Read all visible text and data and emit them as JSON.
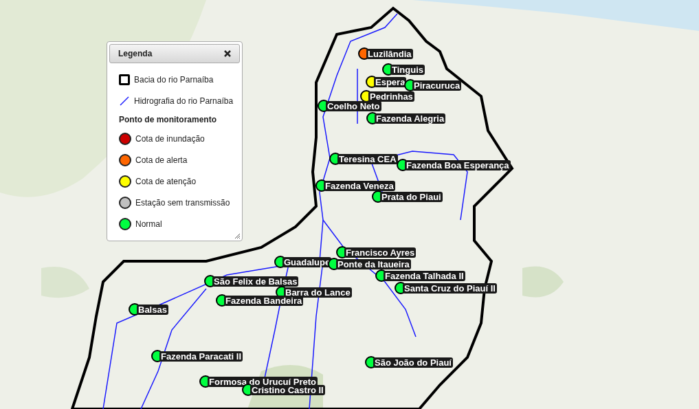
{
  "legend": {
    "title": "Legenda",
    "items": [
      {
        "kind": "basin",
        "label": "Bacia do rio Parnaíba"
      },
      {
        "kind": "river",
        "label": "Hidrografia do rio Parnaíba"
      },
      {
        "kind": "heading",
        "label": "Ponto de monitoramento"
      },
      {
        "kind": "status",
        "label": "Cota de inundação",
        "color": "#cc0000"
      },
      {
        "kind": "status",
        "label": "Cota de alerta",
        "color": "#ff6600"
      },
      {
        "kind": "status",
        "label": "Cota de atenção",
        "color": "#ffff00"
      },
      {
        "kind": "status",
        "label": "Estação sem transmissão",
        "color": "#c0c0c0"
      },
      {
        "kind": "status",
        "label": "Normal",
        "color": "#00ff40"
      }
    ]
  },
  "stations": [
    {
      "label": "Luzilândia",
      "color": "#ff6600"
    },
    {
      "label": "Tinguis",
      "color": "#00ff40"
    },
    {
      "label": "Espera",
      "color": "#ffff00"
    },
    {
      "label": "Piracuruca",
      "color": "#00ff40"
    },
    {
      "label": "Pedrinhas",
      "color": "#ffff00"
    },
    {
      "label": "Coelho Neto",
      "color": "#00ff40"
    },
    {
      "label": "Fazenda Alegria",
      "color": "#00ff40"
    },
    {
      "label": "Teresina CEA",
      "color": "#00ff40"
    },
    {
      "label": "Fazenda Boa Esperança",
      "color": "#00ff40"
    },
    {
      "label": "Fazenda Veneza",
      "color": "#00ff40"
    },
    {
      "label": "Prata do Piaui",
      "color": "#00ff40"
    },
    {
      "label": "Francisco Ayres",
      "color": "#00ff40"
    },
    {
      "label": "Guadalupe",
      "color": "#00ff40"
    },
    {
      "label": "Ponte da Itaueira",
      "color": "#00ff40"
    },
    {
      "label": "Fazenda Talhada II",
      "color": "#00ff40"
    },
    {
      "label": "Santa Cruz do Piauí II",
      "color": "#00ff40"
    },
    {
      "label": "São Felix de Balsas",
      "color": "#00ff40"
    },
    {
      "label": "Barra do Lance",
      "color": "#00ff40"
    },
    {
      "label": "Fazenda Bandeira",
      "color": "#00ff40"
    },
    {
      "label": "Balsas",
      "color": "#00ff40"
    },
    {
      "label": "Fazenda Paracati II",
      "color": "#00ff40"
    },
    {
      "label": "Formosa do Urucuí Preto",
      "color": "#00ff40"
    },
    {
      "label": "Cristino Castro II",
      "color": "#00ff40"
    },
    {
      "label": "São João do Piauí",
      "color": "#00ff40"
    }
  ]
}
